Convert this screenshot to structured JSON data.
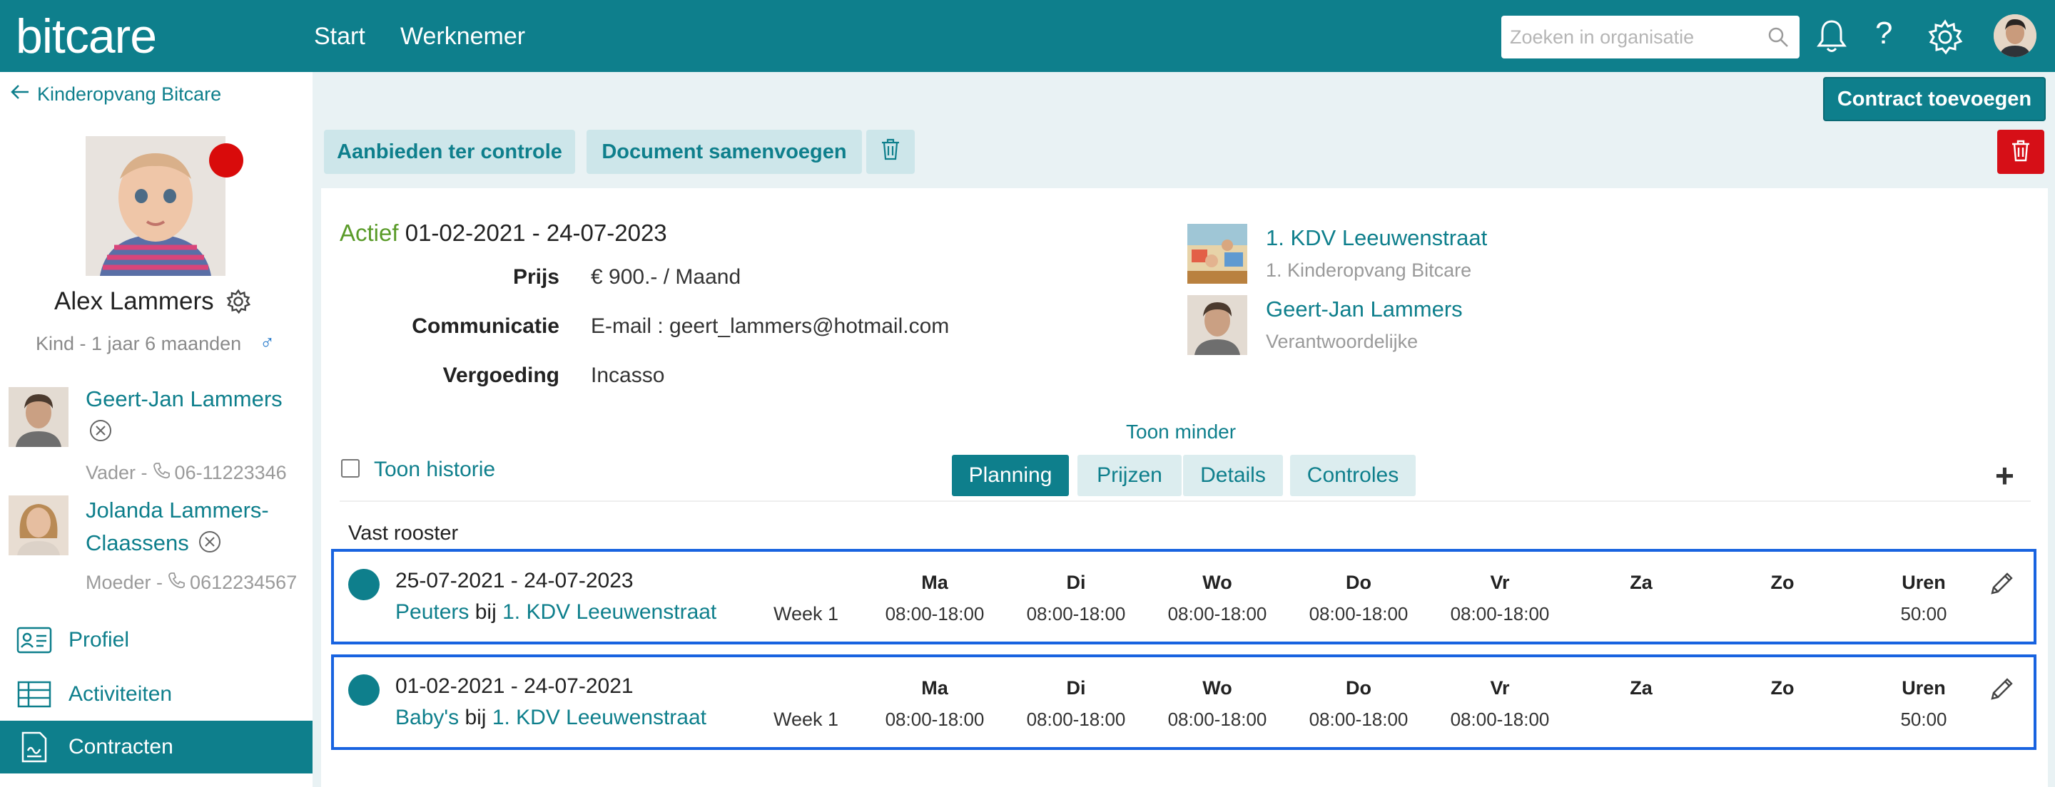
{
  "header": {
    "logo": "bitcare",
    "nav": [
      "Start",
      "Werknemer"
    ],
    "search_placeholder": "Zoeken in organisatie"
  },
  "sidebar": {
    "back_label": "Kinderopvang Bitcare",
    "child": {
      "name": "Alex Lammers",
      "subtitle": "Kind - 1 jaar 6 maanden",
      "gender_symbol": "♂",
      "status_color": "#d90b0b"
    },
    "parents": [
      {
        "name": "Geert-Jan Lammers",
        "role": "Vader -",
        "phone": "06-11223346"
      },
      {
        "name_line1": "Jolanda Lammers-",
        "name_line2": "Claassens",
        "role": "Moeder -",
        "phone": "0612234567"
      }
    ],
    "nav": [
      {
        "label": "Profiel",
        "icon": "id-card-icon"
      },
      {
        "label": "Activiteiten",
        "icon": "table-icon"
      },
      {
        "label": "Contracten",
        "icon": "contract-icon",
        "active": true
      }
    ]
  },
  "toolbar": {
    "add_contract": "Contract toevoegen",
    "offer_review": "Aanbieden ter controle",
    "merge_document": "Document samenvoegen"
  },
  "contract": {
    "status": "Actief",
    "period": "01-02-2021 - 24-07-2023",
    "fields": [
      {
        "label": "Prijs",
        "value": "€ 900.- / Maand"
      },
      {
        "label": "Communicatie",
        "value": "E-mail : geert_lammers@hotmail.com"
      },
      {
        "label": "Vergoeding",
        "value": "Incasso"
      }
    ],
    "location": {
      "title": "1. KDV Leeuwenstraat",
      "subtitle": "1. Kinderopvang Bitcare"
    },
    "responsible": {
      "title": "Geert-Jan Lammers",
      "subtitle": "Verantwoordelijke"
    },
    "toon_minder": "Toon minder",
    "toon_historie": "Toon historie",
    "tabs": [
      "Planning",
      "Prijzen",
      "Details",
      "Controles"
    ],
    "active_tab": "Planning",
    "section_title": "Vast rooster"
  },
  "schedule": {
    "days": [
      "Ma",
      "Di",
      "Wo",
      "Do",
      "Vr",
      "Za",
      "Zo",
      "Uren"
    ],
    "rows": [
      {
        "dates": "25-07-2021 - 24-07-2023",
        "group": "Peuters",
        "bij": "bij",
        "location": "1. KDV Leeuwenstraat",
        "week": "Week 1",
        "times": [
          "08:00-18:00",
          "08:00-18:00",
          "08:00-18:00",
          "08:00-18:00",
          "08:00-18:00",
          "",
          ""
        ],
        "hours": "50:00"
      },
      {
        "dates": "01-02-2021 - 24-07-2021",
        "group": "Baby's",
        "bij": "bij",
        "location": "1. KDV Leeuwenstraat",
        "week": "Week 1",
        "times": [
          "08:00-18:00",
          "08:00-18:00",
          "08:00-18:00",
          "08:00-18:00",
          "08:00-18:00",
          "",
          ""
        ],
        "hours": "50:00"
      }
    ]
  },
  "colors": {
    "brand": "#0e7f8c",
    "active_status": "#5a9b29",
    "danger": "#d60f17",
    "highlight": "#1863e0"
  }
}
